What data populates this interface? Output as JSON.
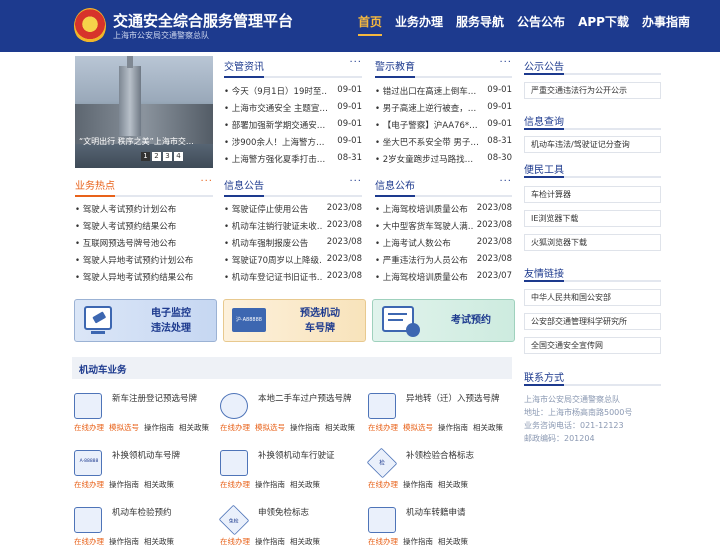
{
  "header": {
    "title": "交通安全综合服务管理平台",
    "subtitle": "上海市公安局交通警察总队",
    "nav": [
      "首页",
      "业务办理",
      "服务导航",
      "公告公布",
      "APP下载",
      "办事指南"
    ]
  },
  "slider": {
    "caption": "“文明出行 秩序之美”上海市交…",
    "dots": [
      "1",
      "2",
      "3",
      "4"
    ]
  },
  "news": {
    "title": "交管资讯",
    "more": "···",
    "items": [
      {
        "t": "今天（9月1日）19时至…",
        "d": "09-01"
      },
      {
        "t": "上海市交通安全 主题宣…",
        "d": "09-01"
      },
      {
        "t": "部署加强新学期交通安…",
        "d": "09-01"
      },
      {
        "t": "涉900余人！上海警方…",
        "d": "09-01"
      },
      {
        "t": "上海警方强化夏季打击…",
        "d": "08-31"
      }
    ]
  },
  "warn": {
    "title": "警示教育",
    "more": "···",
    "items": [
      {
        "t": "错过出口在高速上倒车…",
        "d": "09-01"
      },
      {
        "t": "男子高速上逆行被查，…",
        "d": "09-01"
      },
      {
        "t": "【电子警察】沪AA76*…",
        "d": "09-01"
      },
      {
        "t": "坐大巴不系安全带 男子…",
        "d": "08-31"
      },
      {
        "t": "2岁女童跑步过马路找…",
        "d": "08-30"
      }
    ]
  },
  "hot": {
    "title": "业务热点",
    "more": "···",
    "items": [
      "驾驶人考试预约计划公布",
      "驾驶人考试预约结果公布",
      "互联网预选号牌号池公布",
      "驾驶人异地考试预约计划公布",
      "驾驶人异地考试预约结果公布"
    ]
  },
  "info": {
    "title": "信息公告",
    "more": "···",
    "items": [
      {
        "t": "驾驶证停止使用公告",
        "d": "2023/08"
      },
      {
        "t": "机动车注销行驶证未收…",
        "d": "2023/08"
      },
      {
        "t": "机动车强制报废公告",
        "d": "2023/08"
      },
      {
        "t": "驾驶证70周岁以上降级…",
        "d": "2023/08"
      },
      {
        "t": "机动车登记证书旧证书…",
        "d": "2023/08"
      }
    ]
  },
  "pub": {
    "title": "信息公布",
    "more": "···",
    "items": [
      {
        "t": "上海驾校培训质量公布",
        "d": "2023/08"
      },
      {
        "t": "大中型客货车驾驶人满…",
        "d": "2023/08"
      },
      {
        "t": "上海考试人数公布",
        "d": "2023/08"
      },
      {
        "t": "严重违法行为人员公布",
        "d": "2023/08"
      },
      {
        "t": "上海驾校培训质量公布",
        "d": "2023/07"
      }
    ]
  },
  "banners": {
    "b1": [
      "电子监控",
      "违法处理"
    ],
    "b2": [
      "预选机动",
      "车号牌"
    ],
    "b3": "考试预约",
    "plate_text": "沪·A88888"
  },
  "vehicle": {
    "title": "机动车业务",
    "services": [
      {
        "name": "新车注册登记预选号牌",
        "ops": [
          "在线办理",
          "模拟选号",
          "操作指南",
          "相关政策"
        ]
      },
      {
        "name": "本地二手车过户预选号牌",
        "ops": [
          "在线办理",
          "模拟选号",
          "操作指南",
          "相关政策"
        ]
      },
      {
        "name": "异地转（迁）入预选号牌",
        "ops": [
          "在线办理",
          "模拟选号",
          "操作指南",
          "相关政策"
        ]
      },
      {
        "name": "补换领机动车号牌",
        "ops": [
          "在线办理",
          "操作指南",
          "相关政策"
        ]
      },
      {
        "name": "补换领机动车行驶证",
        "ops": [
          "在线办理",
          "操作指南",
          "相关政策"
        ]
      },
      {
        "name": "补领检验合格标志",
        "ops": [
          "在线办理",
          "操作指南",
          "相关政策"
        ]
      },
      {
        "name": "机动车检验预约",
        "ops": [
          "在线办理",
          "操作指南",
          "相关政策"
        ]
      },
      {
        "name": "申领免检标志",
        "ops": [
          "在线办理",
          "操作指南",
          "相关政策"
        ]
      },
      {
        "name": "机动车转籍申请",
        "ops": [
          "在线办理",
          "操作指南",
          "相关政策"
        ]
      }
    ],
    "icon_texts": {
      "i4": "A·88888",
      "i6": "检",
      "i8": "免检"
    }
  },
  "right": {
    "notice_title": "公示公告",
    "notice_items": [
      "严重交通违法行为公开公示"
    ],
    "query_title": "信息查询",
    "query_items": [
      "机动车违法/驾驶证记分查询"
    ],
    "tools_title": "便民工具",
    "tools_items": [
      "车检计算器",
      "IE浏览器下载",
      "火狐浏览器下载"
    ],
    "links_title": "友情链接",
    "links_items": [
      "中华人民共和国公安部",
      "公安部交通管理科学研究所",
      "全国交通安全宣传网"
    ],
    "contact_title": "联系方式",
    "contact_lines": [
      "上海市公安局交通警察总队",
      "地址：上海市杨高南路5000号",
      "业务咨询电话：021-12123",
      "邮政编码：201204"
    ]
  },
  "colors": {
    "primary": "#1d3a8e",
    "accent": "#e8621a",
    "nav_active": "#f5b83f"
  }
}
